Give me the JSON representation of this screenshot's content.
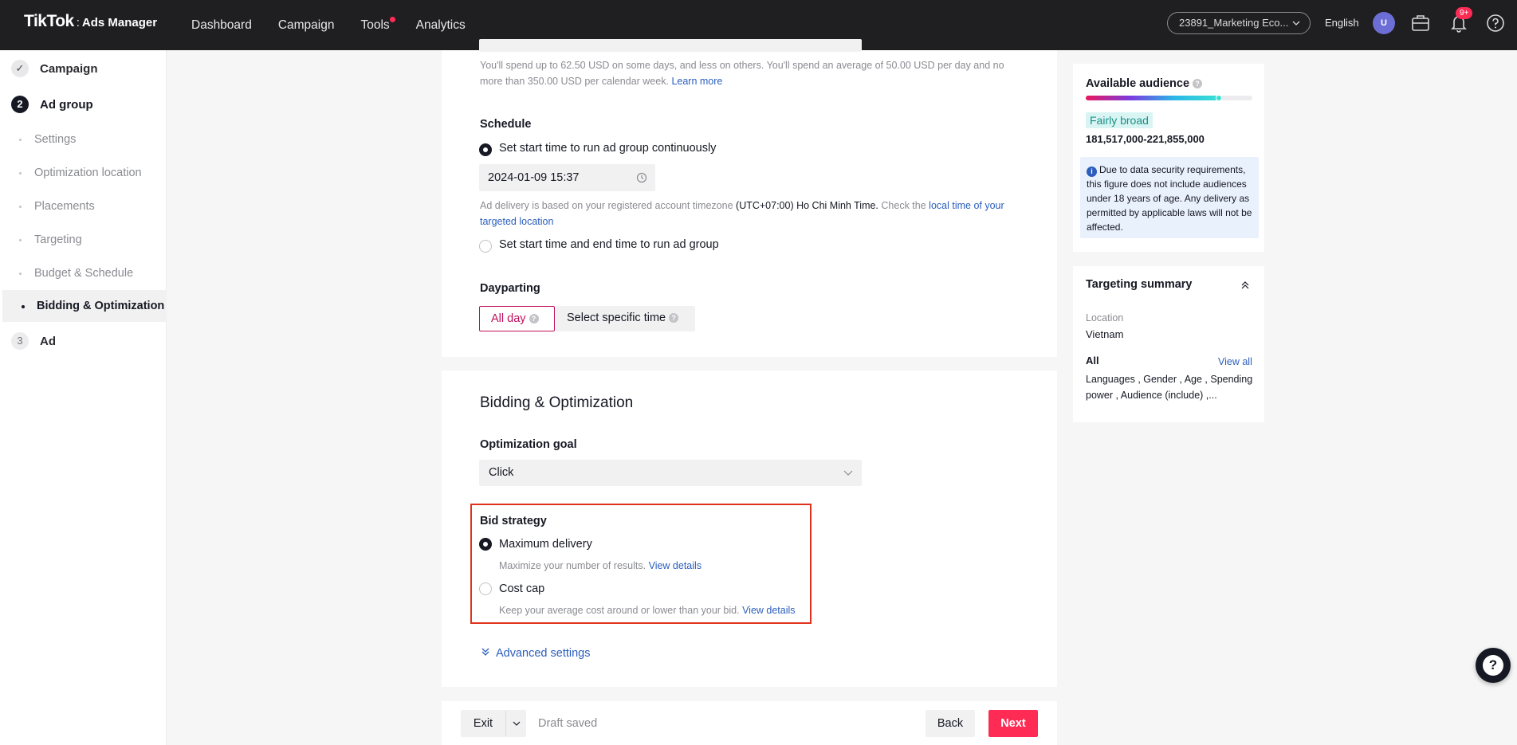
{
  "topbar": {
    "logo_brand": "TikTok",
    "logo_sep": ":",
    "logo_product": "Ads Manager",
    "nav": [
      "Dashboard",
      "Campaign",
      "Tools",
      "Analytics"
    ],
    "account": "23891_Marketing Eco...",
    "language": "English",
    "avatar_initial": "U",
    "notification_badge": "9+"
  },
  "sidebar": {
    "steps": [
      {
        "num": "✓",
        "label": "Campaign"
      },
      {
        "num": "2",
        "label": "Ad group"
      },
      {
        "num": "3",
        "label": "Ad"
      }
    ],
    "subitems": [
      "Settings",
      "Optimization location",
      "Placements",
      "Targeting",
      "Budget & Schedule",
      "Bidding & Optimization"
    ]
  },
  "budget": {
    "spend_text": "You'll spend up to 62.50 USD on some days, and less on others. You'll spend an average of 50.00 USD per day and no more than 350.00 USD per calendar week.",
    "learn_more": "Learn more"
  },
  "schedule": {
    "title": "Schedule",
    "option_continuous": "Set start time to run ad group continuously",
    "start_time": "2024-01-09 15:37",
    "timezone_note_pre": "Ad delivery is based on your registered account timezone",
    "timezone_value": "(UTC+07:00) Ho Chi Minh Time.",
    "timezone_note_mid": "Check the",
    "timezone_link": "local time of your targeted location",
    "option_start_end": "Set start time and end time to run ad group"
  },
  "dayparting": {
    "title": "Dayparting",
    "all_day": "All day",
    "specific": "Select specific time"
  },
  "bidding": {
    "title": "Bidding & Optimization",
    "goal_label": "Optimization goal",
    "goal_value": "Click",
    "strategy_label": "Bid strategy",
    "max_delivery": "Maximum delivery",
    "max_delivery_desc": "Maximize your number of results.",
    "cost_cap": "Cost cap",
    "cost_cap_desc": "Keep your average cost around or lower than your bid.",
    "view_details": "View details",
    "advanced": "Advanced settings"
  },
  "footer": {
    "exit": "Exit",
    "draft": "Draft saved",
    "back": "Back",
    "next": "Next"
  },
  "audience": {
    "title": "Available audience",
    "level": "Fairly broad",
    "level_fraction": 0.8,
    "range": "181,517,000-221,855,000",
    "note": "Due to data security requirements, this figure does not include audiences under 18 years of age. Any delivery as permitted by applicable laws will not be affected."
  },
  "targeting": {
    "title": "Targeting summary",
    "location_label": "Location",
    "location_value": "Vietnam",
    "all_label": "All",
    "view_all": "View all",
    "all_value": "Languages , Gender , Age , Spending power , Audience (include) ,..."
  },
  "colors": {
    "accent": "#fe2c55",
    "link": "#2b5ebd",
    "highlight_box": "#e0311c"
  }
}
